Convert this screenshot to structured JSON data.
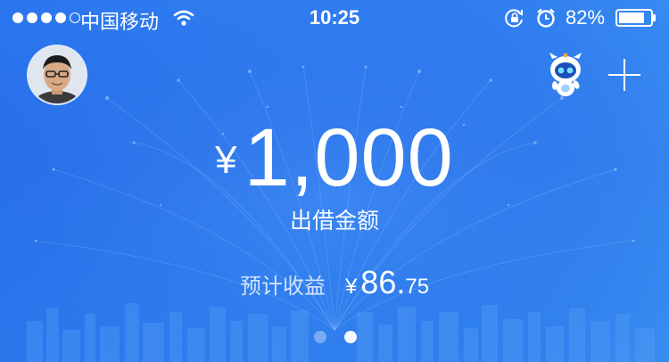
{
  "status_bar": {
    "carrier": "中国移动",
    "time": "10:25",
    "battery_percent": "82%",
    "battery_level": 0.82,
    "signal_bars_filled": 4,
    "signal_bars_total": 5
  },
  "header": {
    "avatar_icon": "user-avatar",
    "assistant_icon": "robot-mascot-icon",
    "add_icon": "plus-icon"
  },
  "amount": {
    "currency": "¥",
    "value": "1,000",
    "label": "出借金额"
  },
  "income": {
    "label": "预计收益",
    "currency": "¥",
    "integer": "86.",
    "decimal": "75"
  },
  "pager": {
    "total": 2,
    "active_index": 1
  },
  "colors": {
    "background": "#2f7cf0",
    "text": "#ffffff"
  }
}
